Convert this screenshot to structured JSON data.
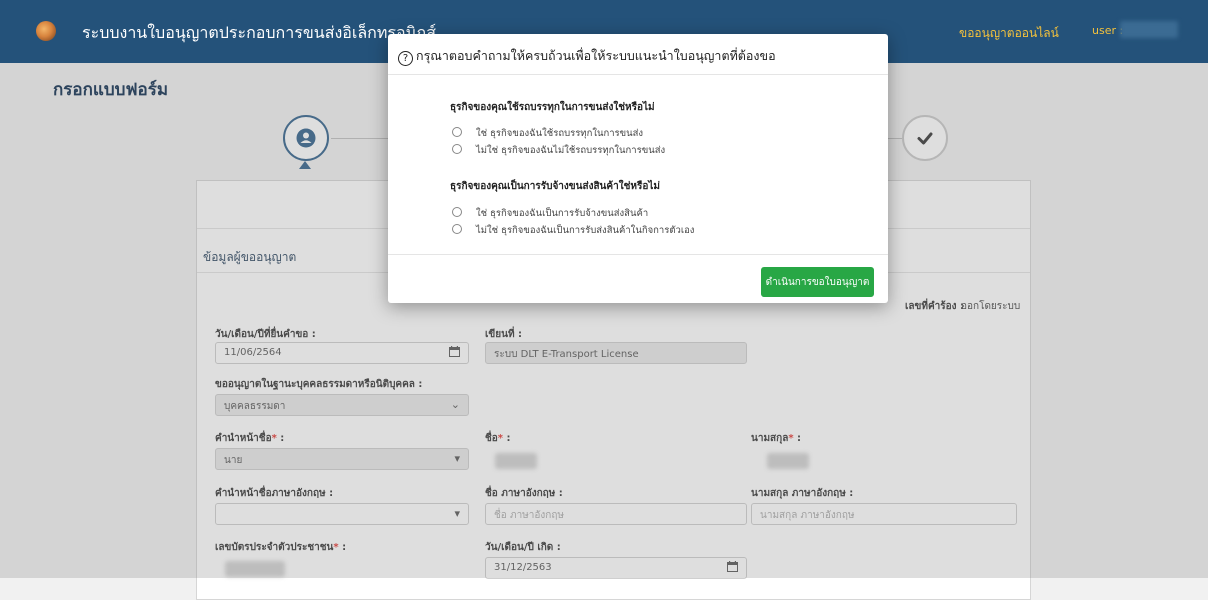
{
  "app": {
    "title": "ระบบงานใบอนุญาตประกอบการขนส่งอิเล็กทรอนิกส์",
    "nav_link": "ขออนุญาตออนไลน์",
    "user_label": "user :"
  },
  "page": {
    "heading": "กรอกแบบฟอร์ม"
  },
  "form": {
    "section_title": "ข้อมูลผู้ขออนุญาต",
    "request_no_label": "เลขที่คำร้อง :",
    "request_no_value": "ออกโดยระบบ",
    "date_label": "วัน/เดือน/ปีที่ยื่นคำขอ :",
    "date_value": "11/06/2564",
    "written_at_label": "เขียนที่ :",
    "written_at_value": "ระบบ DLT E-Transport License",
    "type_label": "ขออนุญาตในฐานะบุคคลธรรมดาหรือนิติบุคคล :",
    "type_value": "บุคคลธรรมดา",
    "prefix_label": "คำนำหน้าชื่อ",
    "prefix_value": "นาย",
    "first_name_label": "ชื่อ",
    "last_name_label": "นามสกุล",
    "prefix_en_label": "คำนำหน้าชื่อภาษาอังกฤษ :",
    "first_name_en_label": "ชื่อ ภาษาอังกฤษ :",
    "first_name_en_placeholder": "ชื่อ ภาษาอังกฤษ",
    "last_name_en_label": "นามสกุล ภาษาอังกฤษ :",
    "last_name_en_placeholder": "นามสกุล ภาษาอังกฤษ",
    "id_card_label": "เลขบัตรประจำตัวประชาชน",
    "birth_label": "วัน/เดือน/ปี เกิด :",
    "birth_value": "31/12/2563"
  },
  "modal": {
    "title": "กรุณาตอบคำถามให้ครบถ้วนเพื่อให้ระบบแนะนำใบอนุญาตที่ต้องขอ",
    "questions": [
      {
        "heading": "ธุรกิจของคุณใช้รถบรรทุกในการขนส่งใช่หรือไม่",
        "options": [
          "ใช่ ธุรกิจของฉันใช้รถบรรทุกในการขนส่ง",
          "ไม่ใช่ ธุรกิจของฉันไม่ใช้รถบรรทุกในการขนส่ง"
        ]
      },
      {
        "heading": "ธุรกิจของคุณเป็นการรับจ้างขนส่งสินค้าใช่หรือไม่",
        "options": [
          "ใช่ ธุรกิจของฉันเป็นการรับจ้างขนส่งสินค้า",
          "ไม่ใช่ ธุรกิจของฉันเป็นการรับส่งสินค้าในกิจการตัวเอง"
        ]
      }
    ],
    "submit_label": "ดำเนินการขอใบอนุญาต"
  },
  "icons": {
    "step1": "user-icon",
    "step4": "check-icon",
    "calendar": "calendar-icon",
    "question": "question-circle-icon"
  },
  "colors": {
    "nav_bg": "#24527a",
    "nav_link": "#f4c23c",
    "button": "#28a745",
    "required": "#e3342f"
  }
}
